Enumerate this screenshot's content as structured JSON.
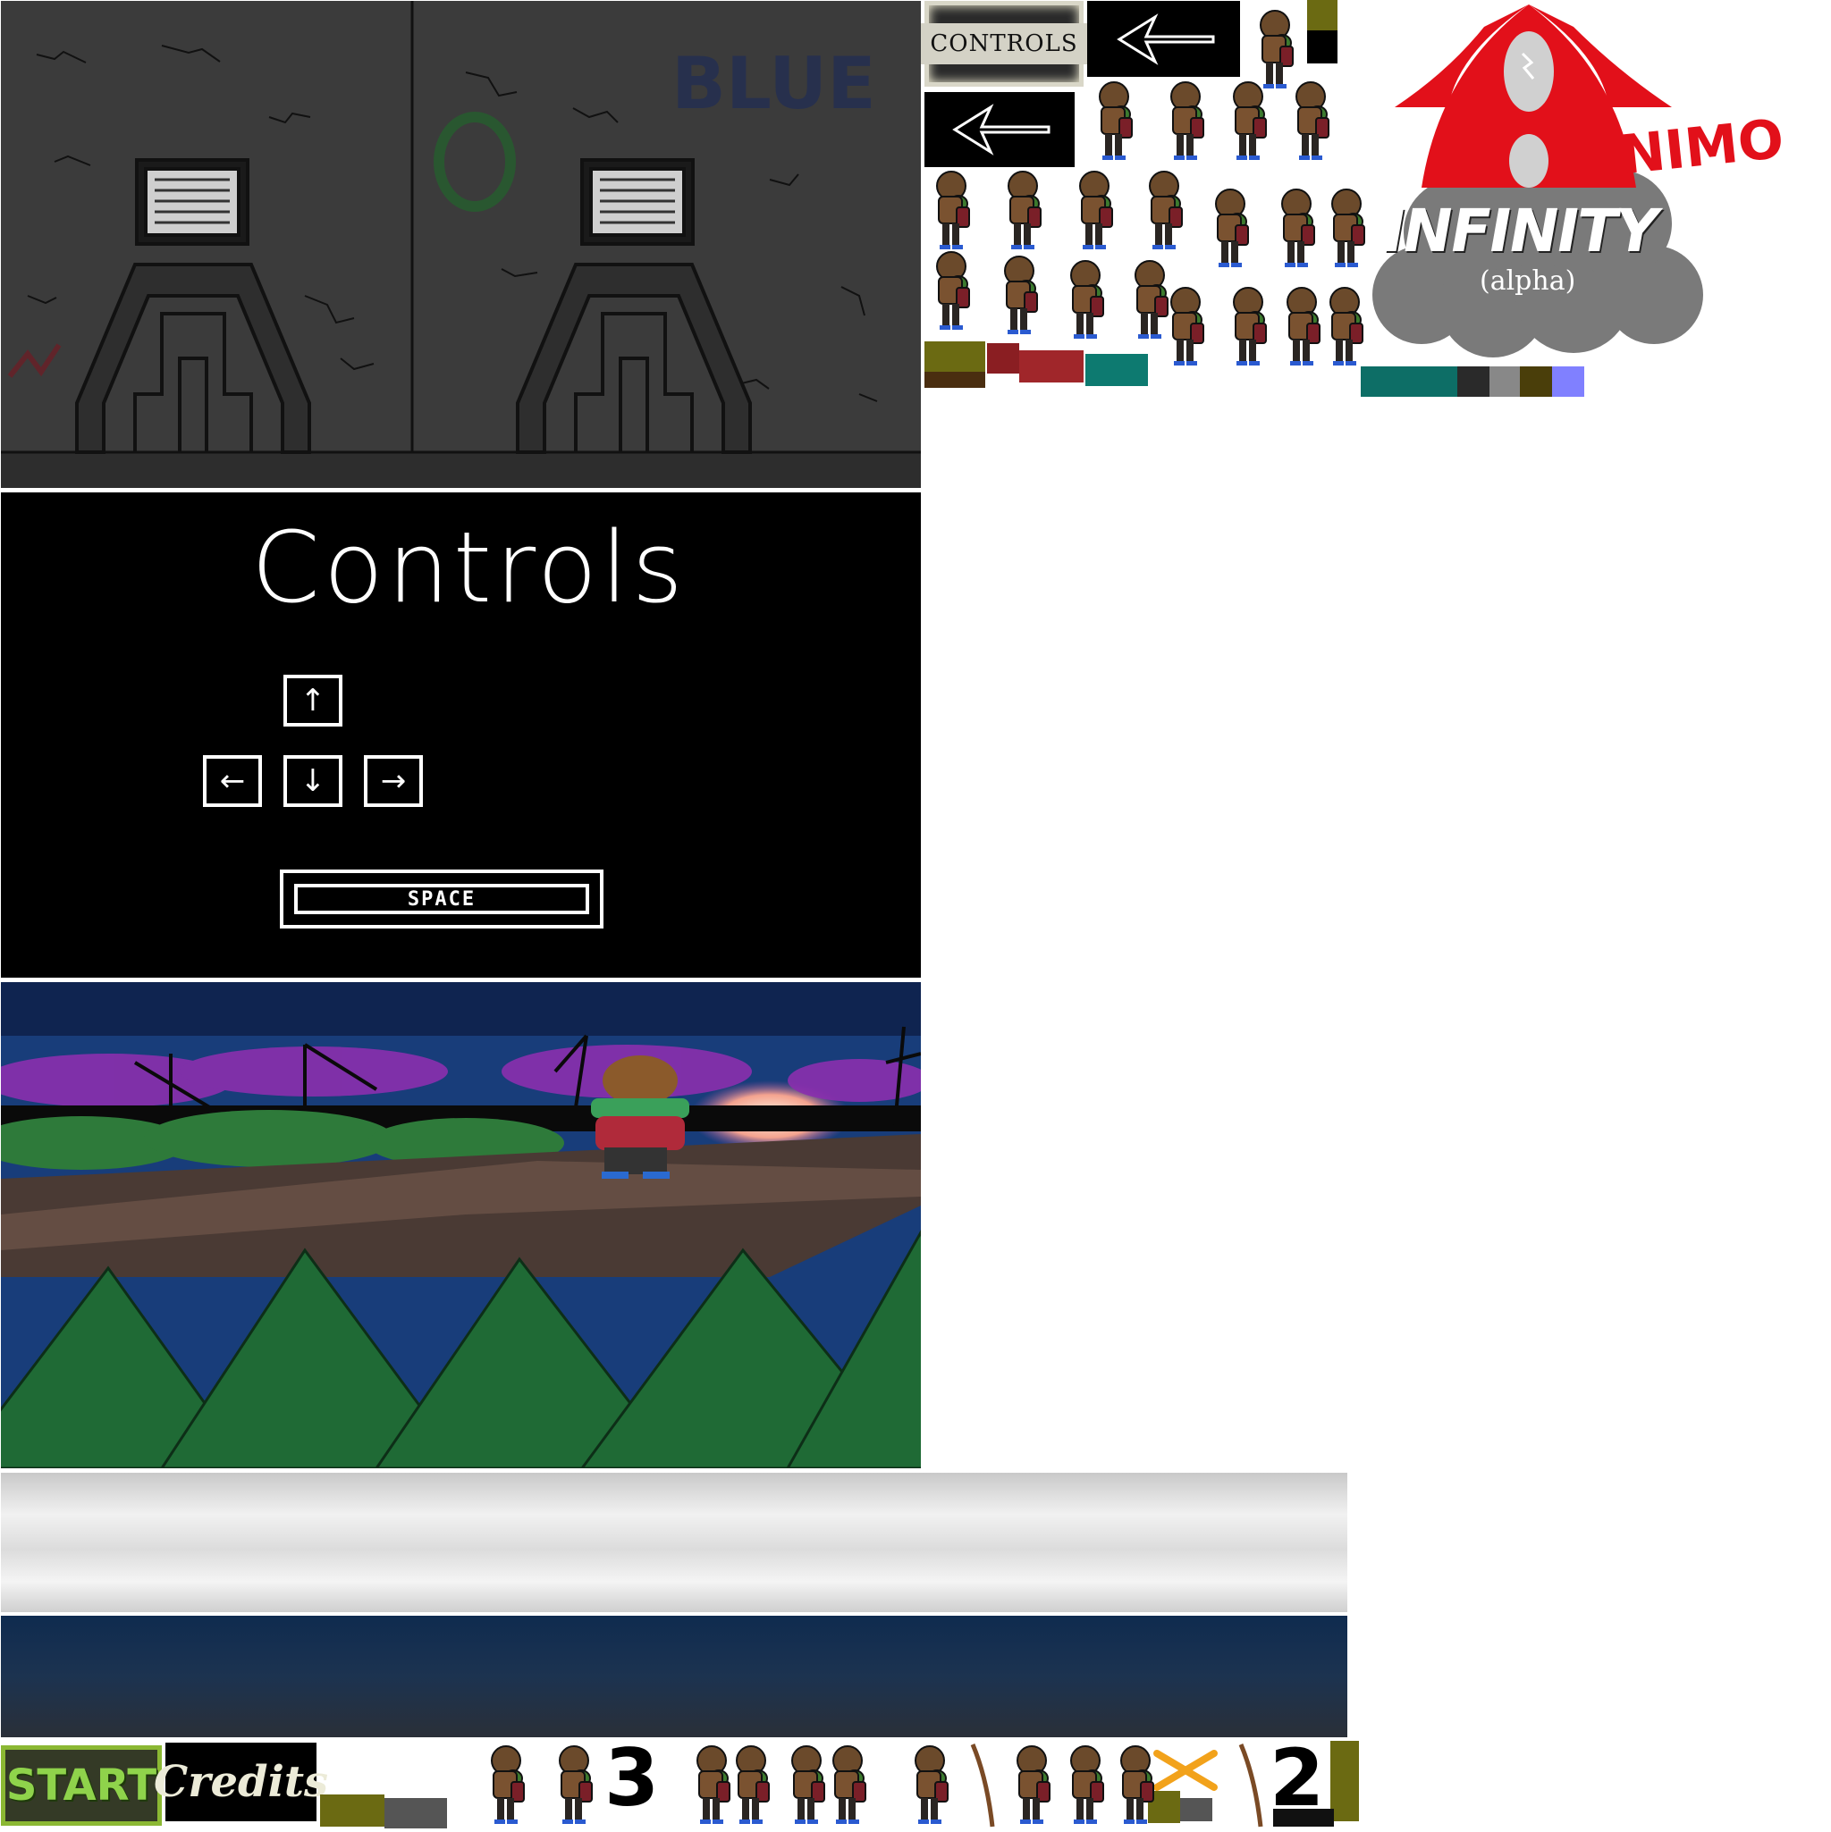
{
  "lab_panel": {
    "graffiti_tag": "BLUE"
  },
  "controls_screen": {
    "title": "Controls",
    "keys": {
      "up": "↑",
      "left": "←",
      "down": "↓",
      "right": "→"
    },
    "space_label": "SPACE"
  },
  "sprites": {
    "controls_button_label": "CONTROLS",
    "start_button_label": "START",
    "credits_button_label": "Credits",
    "digit_a": "3",
    "digit_b": "2"
  },
  "logo": {
    "word_nimo": "NIMO",
    "word_infinity": "INFINITY",
    "subtitle": "(alpha)"
  },
  "colors": {
    "logo_red": "#e2101a",
    "start_green": "#8fd34b",
    "palette_teal": "#0d7a70",
    "palette_olive": "#6b6a12",
    "palette_lavender": "#8080ff"
  }
}
